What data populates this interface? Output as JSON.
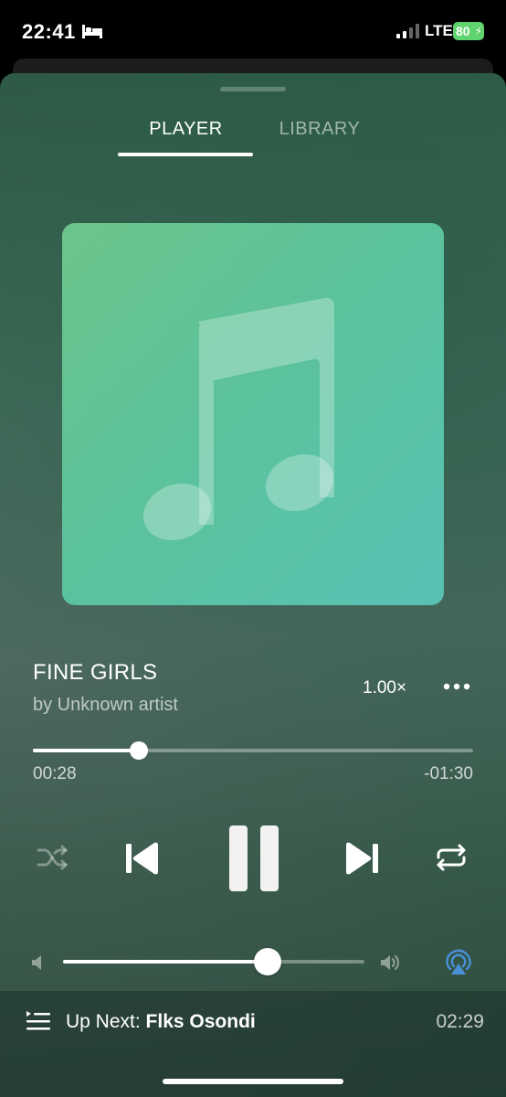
{
  "status_bar": {
    "time": "22:41",
    "network": "LTE",
    "battery": "80",
    "battery_color": "#5fd36e",
    "icons": [
      "bed-icon",
      "signal-icon",
      "bolt-icon"
    ]
  },
  "tabs": [
    {
      "label": "PLAYER",
      "active": true
    },
    {
      "label": "LIBRARY",
      "active": false
    }
  ],
  "artwork": {
    "icon": "music-note-icon",
    "gradient": [
      "#6cc48a",
      "#58c1b4"
    ]
  },
  "track": {
    "title": "FINE GIRLS",
    "artist": "by Unknown artist",
    "speed": "1.00×"
  },
  "progress": {
    "elapsed": "00:28",
    "remaining": "-01:30",
    "fraction": 0.24
  },
  "controls": [
    "shuffle-icon",
    "previous-icon",
    "pause-icon",
    "next-icon",
    "repeat-icon"
  ],
  "volume": {
    "fraction": 0.68,
    "airplay_color": "#4a90d9"
  },
  "up_next": {
    "label": "Up Next:",
    "track": "Flks Osondi",
    "duration": "02:29"
  }
}
